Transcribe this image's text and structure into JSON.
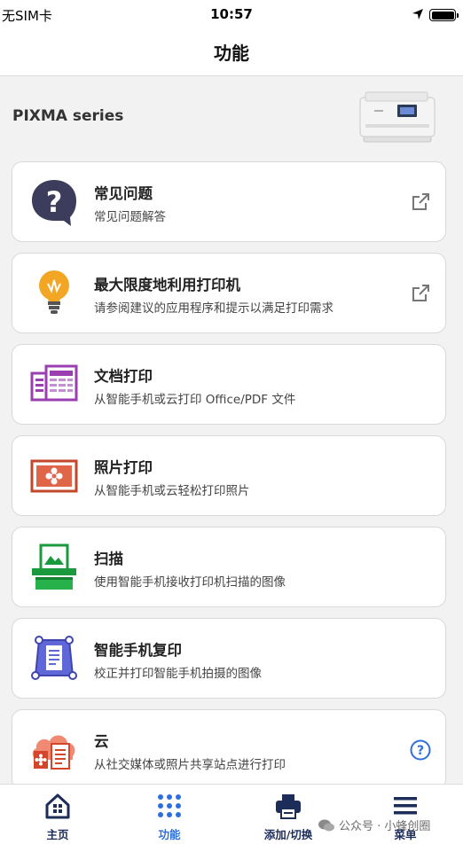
{
  "status": {
    "carrier": "无SIM卡",
    "time": "10:57"
  },
  "nav": {
    "title": "功能"
  },
  "printer": {
    "name": "PIXMA series"
  },
  "cards": [
    {
      "title": "常见问题",
      "desc": "常见问题解答",
      "icon": "question-bubble-icon",
      "action": "external-link-icon"
    },
    {
      "title": "最大限度地利用打印机",
      "desc": "请参阅建议的应用程序和提示以满足打印需求",
      "icon": "lightbulb-icon",
      "action": "external-link-icon"
    },
    {
      "title": "文档打印",
      "desc": "从智能手机或云打印 Office/PDF 文件",
      "icon": "document-print-icon"
    },
    {
      "title": "照片打印",
      "desc": "从智能手机或云轻松打印照片",
      "icon": "photo-print-icon"
    },
    {
      "title": "扫描",
      "desc": "使用智能手机接收打印机扫描的图像",
      "icon": "scan-icon"
    },
    {
      "title": "智能手机复印",
      "desc": "校正并打印智能手机拍摄的图像",
      "icon": "smartphone-copy-icon"
    },
    {
      "title": "云",
      "desc": "从社交媒体或照片共享站点进行打印",
      "icon": "cloud-icon",
      "action": "help-circle-icon"
    }
  ],
  "tabs": [
    {
      "label": "主页",
      "icon": "home-icon"
    },
    {
      "label": "功能",
      "icon": "grid-dots-icon",
      "active": true
    },
    {
      "label": "添加/切换",
      "icon": "printer-icon"
    },
    {
      "label": "菜单",
      "icon": "menu-icon"
    }
  ],
  "watermark": {
    "text": "公众号 · 小蜂创圈"
  },
  "colors": {
    "accent": "#2f6fdc",
    "navy": "#1c2d5a",
    "background": "#f2f2f2"
  }
}
